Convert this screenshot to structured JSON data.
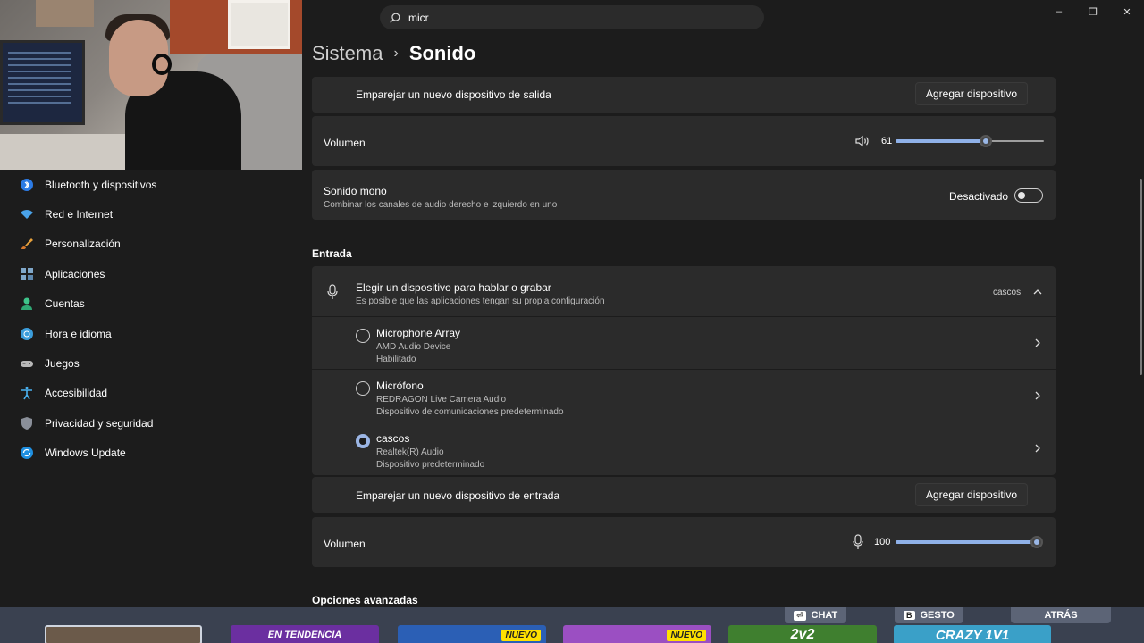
{
  "search": {
    "value": "micr"
  },
  "window": {
    "minimize": "–",
    "maximize": "❐",
    "close": "✕"
  },
  "breadcrumb": {
    "parent": "Sistema",
    "separator": "›",
    "current": "Sonido"
  },
  "sidebar": {
    "items": [
      {
        "label": "Bluetooth y dispositivos",
        "icon": "bluetooth-icon"
      },
      {
        "label": "Red e Internet",
        "icon": "wifi-icon"
      },
      {
        "label": "Personalización",
        "icon": "brush-icon"
      },
      {
        "label": "Aplicaciones",
        "icon": "apps-icon"
      },
      {
        "label": "Cuentas",
        "icon": "account-icon"
      },
      {
        "label": "Hora e idioma",
        "icon": "globe-clock-icon"
      },
      {
        "label": "Juegos",
        "icon": "gamepad-icon"
      },
      {
        "label": "Accesibilidad",
        "icon": "accessibility-icon"
      },
      {
        "label": "Privacidad y seguridad",
        "icon": "shield-icon"
      },
      {
        "label": "Windows Update",
        "icon": "update-icon"
      }
    ]
  },
  "output": {
    "pair_label": "Emparejar un nuevo dispositivo de salida",
    "pair_button": "Agregar dispositivo",
    "volume_label": "Volumen",
    "volume_value": "61",
    "volume_level": 0.61,
    "mono_label": "Sonido mono",
    "mono_sub": "Combinar los canales de audio derecho e izquierdo en uno",
    "mono_state": "Desactivado"
  },
  "input": {
    "section_title": "Entrada",
    "choose_label": "Elegir un dispositivo para hablar o grabar",
    "choose_sub": "Es posible que las aplicaciones tengan su propia configuración",
    "selected": "cascos",
    "devices": [
      {
        "name": "Microphone Array",
        "driver": "AMD Audio Device",
        "status": "Habilitado",
        "selected": false
      },
      {
        "name": "Micrófono",
        "driver": "REDRAGON Live Camera Audio",
        "status": "Dispositivo de comunicaciones predeterminado",
        "selected": false
      },
      {
        "name": "cascos",
        "driver": "Realtek(R) Audio",
        "status": "Dispositivo predeterminado",
        "selected": true
      }
    ],
    "pair_label": "Emparejar un nuevo dispositivo de entrada",
    "pair_button": "Agregar dispositivo",
    "volume_label": "Volumen",
    "volume_value": "100",
    "volume_level": 1.0
  },
  "advanced_title": "Opciones avanzadas",
  "game_overlay": {
    "chat": "CHAT",
    "chat_key": "⏎",
    "gesture": "GESTO",
    "gesture_key": "B",
    "back": "ATRÁS",
    "trending": "EN TENDENCIA",
    "new1": "NUEVO",
    "new2": "NUEVO",
    "mode": "2v2",
    "crazy": "CRAZY 1V1"
  }
}
